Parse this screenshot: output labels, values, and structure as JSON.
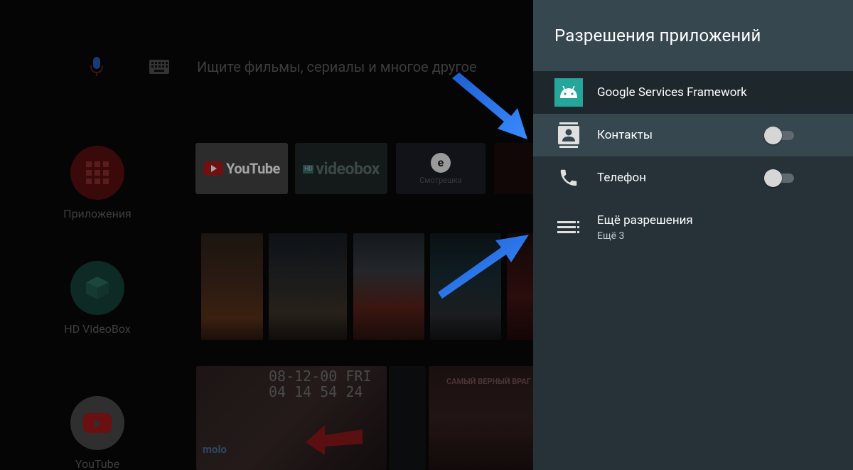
{
  "launcher": {
    "search_placeholder": "Ищите фильмы, сериалы и многое другое",
    "side_apps": [
      {
        "label": "Приложения"
      },
      {
        "label": "HD VideoBox"
      },
      {
        "label": "YouTube"
      }
    ],
    "tiles": {
      "youtube": "YouTube",
      "videobox_badge": "HD",
      "videobox": "videobox",
      "smotreshka_letter": "e",
      "smotreshka": "Смотрешка"
    },
    "thumbs": {
      "clock_line1": "08-12-00 FRI",
      "clock_line2": "04 14 54  24",
      "brand": "molo",
      "title": "САМЫЙ ВЕРНЫЙ ВРАГ"
    }
  },
  "panel": {
    "title": "Разрешения приложений",
    "app_name": "Google Services Framework",
    "permissions": [
      {
        "label": "Контакты",
        "enabled": false,
        "focused": true,
        "icon": "contacts-icon"
      },
      {
        "label": "Телефон",
        "enabled": false,
        "focused": false,
        "icon": "phone-icon"
      }
    ],
    "more": {
      "label": "Ещё разрешения",
      "sublabel": "Ещё 3",
      "icon": "list-icon"
    }
  },
  "colors": {
    "panel_bg": "#263238",
    "panel_header": "#37474f",
    "app_icon_bg": "#26a69a",
    "arrow": "#2f7cf6"
  }
}
